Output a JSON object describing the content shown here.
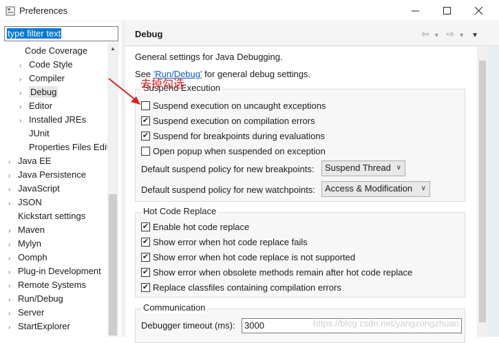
{
  "window": {
    "title": "Preferences"
  },
  "filter": {
    "value": "type filter text"
  },
  "tree": {
    "items": [
      {
        "label": "Code Coverage",
        "expandable": false,
        "level": 2,
        "chevron": "up"
      },
      {
        "label": "Code Style",
        "expandable": true,
        "level": 2
      },
      {
        "label": "Compiler",
        "expandable": true,
        "level": 2
      },
      {
        "label": "Debug",
        "expandable": true,
        "level": 2,
        "selected": true
      },
      {
        "label": "Editor",
        "expandable": true,
        "level": 2
      },
      {
        "label": "Installed JREs",
        "expandable": true,
        "level": 2
      },
      {
        "label": "JUnit",
        "expandable": false,
        "level": 2
      },
      {
        "label": "Properties Files Edit",
        "expandable": false,
        "level": 2
      },
      {
        "label": "Java EE",
        "expandable": true,
        "level": 1
      },
      {
        "label": "Java Persistence",
        "expandable": true,
        "level": 1
      },
      {
        "label": "JavaScript",
        "expandable": true,
        "level": 1
      },
      {
        "label": "JSON",
        "expandable": true,
        "level": 1
      },
      {
        "label": "Kickstart settings",
        "expandable": false,
        "level": 1
      },
      {
        "label": "Maven",
        "expandable": true,
        "level": 1
      },
      {
        "label": "Mylyn",
        "expandable": true,
        "level": 1
      },
      {
        "label": "Oomph",
        "expandable": true,
        "level": 1
      },
      {
        "label": "Plug-in Development",
        "expandable": true,
        "level": 1
      },
      {
        "label": "Remote Systems",
        "expandable": true,
        "level": 1
      },
      {
        "label": "Run/Debug",
        "expandable": true,
        "level": 1
      },
      {
        "label": "Server",
        "expandable": true,
        "level": 1
      },
      {
        "label": "StartExplorer",
        "expandable": true,
        "level": 1
      }
    ]
  },
  "page": {
    "title": "Debug",
    "general": "General settings for Java Debugging.",
    "see_prefix": "See ",
    "see_link": "'Run/Debug'",
    "see_suffix": " for general debug settings."
  },
  "suspend": {
    "title": "Suspend Execution",
    "options": [
      {
        "label": "Suspend execution on uncaught exceptions",
        "checked": false
      },
      {
        "label": "Suspend execution on compilation errors",
        "checked": true
      },
      {
        "label": "Suspend for breakpoints during evaluations",
        "checked": true
      },
      {
        "label": "Open popup when suspended on exception",
        "checked": false
      }
    ],
    "breakpoint_policy_label": "Default suspend policy for new breakpoints:",
    "breakpoint_policy_value": "Suspend Thread",
    "watchpoint_policy_label": "Default suspend policy for new watchpoints:",
    "watchpoint_policy_value": "Access & Modification"
  },
  "hcr": {
    "title": "Hot Code Replace",
    "options": [
      {
        "label": "Enable hot code replace",
        "checked": true
      },
      {
        "label": "Show error when hot code replace fails",
        "checked": true
      },
      {
        "label": "Show error when hot code replace is not supported",
        "checked": true
      },
      {
        "label": "Show error when obsolete methods remain after hot code replace",
        "checked": true
      },
      {
        "label": "Replace classfiles containing compilation errors",
        "checked": true
      }
    ]
  },
  "communication": {
    "title": "Communication",
    "timeout_label": "Debugger timeout (ms):",
    "timeout_value": "3000"
  },
  "annotation": {
    "text": "去掉勾选"
  },
  "watermark": "https://blog.csdn.net/yangzongzhuan",
  "colors": {
    "selection": "#0078d7",
    "link": "#0a5bc7",
    "annotation": "#e02020"
  }
}
